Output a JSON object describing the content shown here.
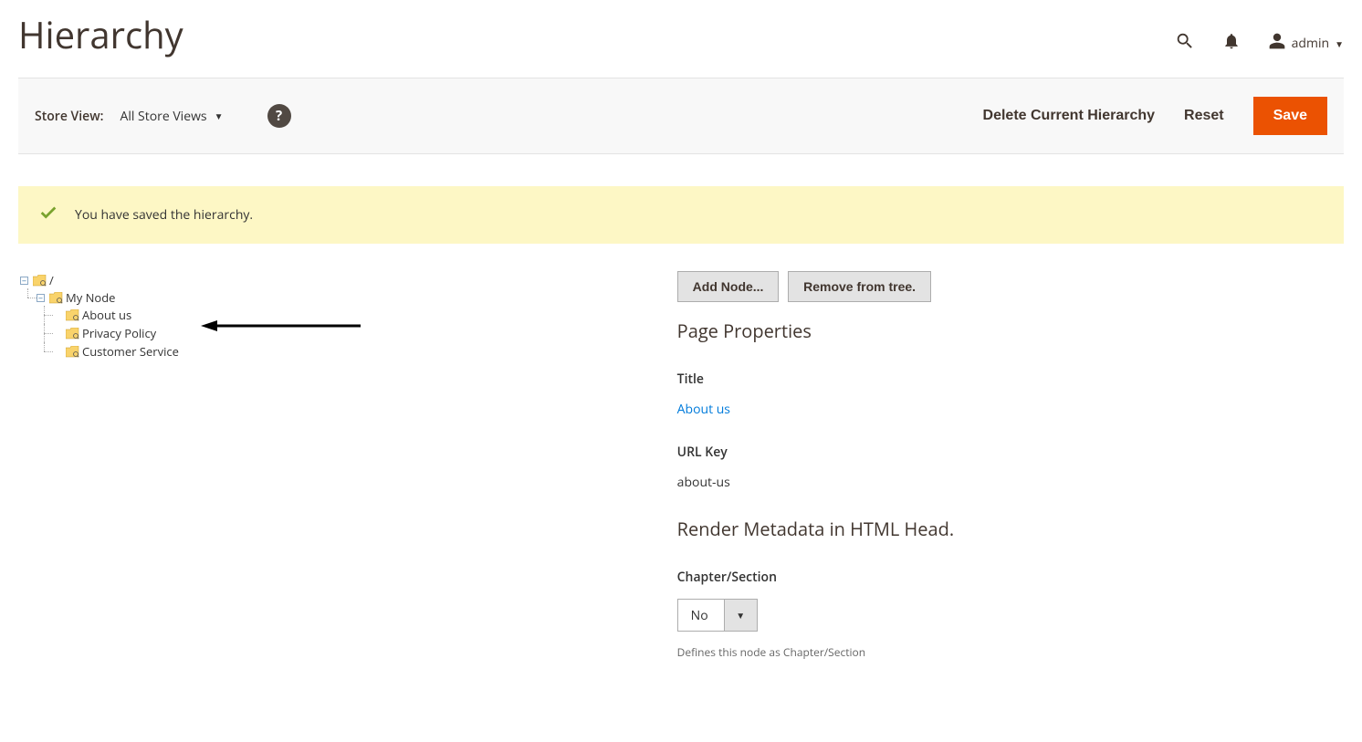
{
  "page": {
    "title": "Hierarchy"
  },
  "header": {
    "user_name": "admin"
  },
  "toolbar": {
    "store_view_label": "Store View:",
    "store_view_value": "All Store Views",
    "delete_label": "Delete Current Hierarchy",
    "reset_label": "Reset",
    "save_label": "Save"
  },
  "message": {
    "success": "You have saved the hierarchy."
  },
  "tree": {
    "root_label": "/",
    "nodes": [
      {
        "label": "My Node",
        "children": [
          {
            "label": "About us"
          },
          {
            "label": "Privacy Policy"
          },
          {
            "label": "Customer Service"
          }
        ]
      }
    ]
  },
  "buttons": {
    "add_node": "Add Node...",
    "remove_from_tree": "Remove from tree."
  },
  "props": {
    "section_title": "Page Properties",
    "title_label": "Title",
    "title_value": "About us",
    "urlkey_label": "URL Key",
    "urlkey_value": "about-us",
    "render_heading": "Render Metadata in HTML Head.",
    "chapter_label": "Chapter/Section",
    "chapter_value": "No",
    "chapter_note": "Defines this node as Chapter/Section"
  }
}
